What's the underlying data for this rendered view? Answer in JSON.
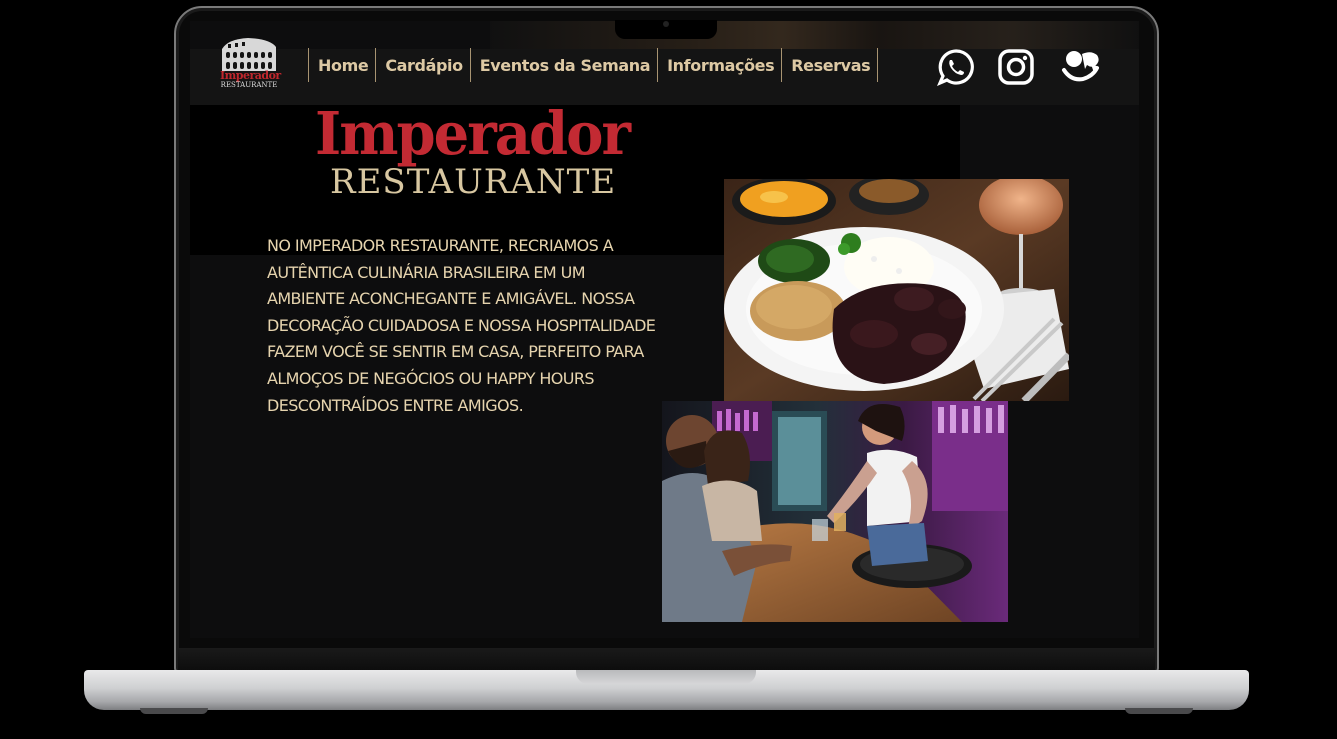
{
  "site": {
    "logo": {
      "word": "Imperador",
      "sub": "RESTAURANTE"
    },
    "nav": [
      {
        "label": "Home"
      },
      {
        "label": "Cardápio"
      },
      {
        "label": "Eventos da Semana"
      },
      {
        "label": "Informações"
      },
      {
        "label": "Reservas"
      }
    ],
    "social": [
      "whatsapp-icon",
      "instagram-icon",
      "messenger-icon"
    ],
    "title": {
      "main": "Imperador",
      "sub": "RESTAURANTE"
    },
    "about": "NO IMPERADOR RESTAURANTE, RECRIAMOS A AUTÊNTICA CULINÁRIA BRASILEIRA EM UM AMBIENTE ACONCHEGANTE E AMIGÁVEL. NOSSA DECORAÇÃO CUIDADOSA E NOSSA HOSPITALIDADE FAZEM VOCÊ SE SENTIR EM CASA, PERFEITO PARA ALMOÇOS DE NEGÓCIOS OU HAPPY HOURS DESCONTRAÍDOS ENTRE AMIGOS.",
    "colors": {
      "brand_red": "#c32a33",
      "accent_gold": "#ddc9a4",
      "background": "#0d0d0e"
    }
  }
}
